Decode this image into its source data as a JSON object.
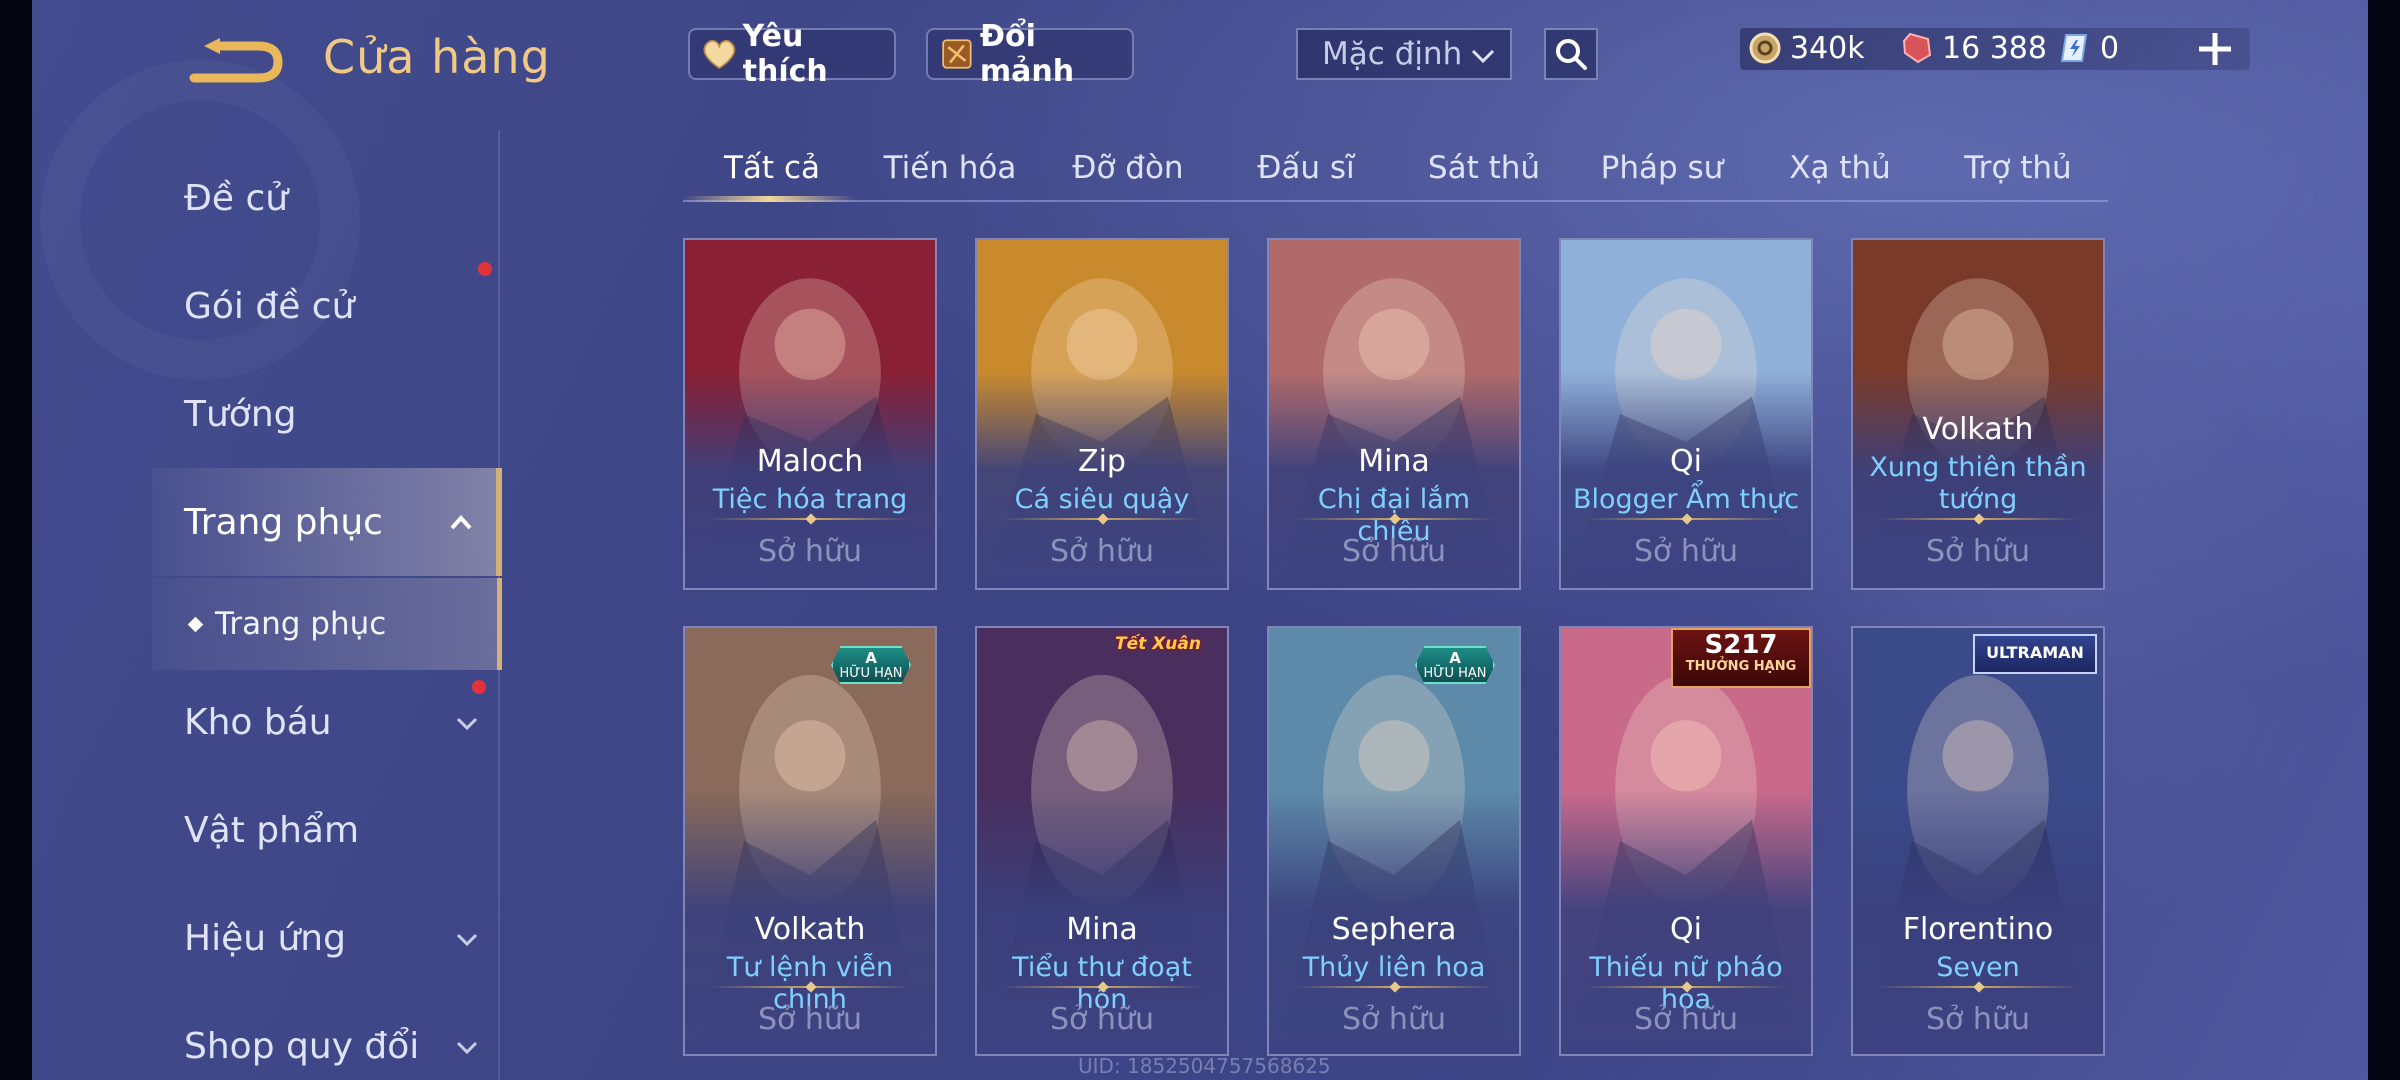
{
  "header": {
    "title": "Cửa hàng",
    "favorites_label": "Yêu thích",
    "exchange_label": "Đổi mảnh",
    "sort_value": "Mặc định"
  },
  "currency": {
    "gold": "340k",
    "gems": "16 388",
    "vouchers": "0"
  },
  "sidebar": {
    "items": [
      {
        "label": "Đề cử"
      },
      {
        "label": "Gói đề cử"
      },
      {
        "label": "Tướng"
      },
      {
        "label": "Trang phục"
      },
      {
        "label": "Kho báu"
      },
      {
        "label": "Vật phẩm"
      },
      {
        "label": "Hiệu ứng"
      },
      {
        "label": "Shop quy đổi"
      }
    ],
    "sub_item": "Trang phục"
  },
  "tabs": [
    "Tất cả",
    "Tiến hóa",
    "Đỡ đòn",
    "Đấu sĩ",
    "Sát thủ",
    "Pháp sư",
    "Xạ thủ",
    "Trợ thủ"
  ],
  "cards": [
    {
      "hero": "Maloch",
      "skin": "Tiệc hóa trang",
      "status": "Sở hữu",
      "art": "#8a2035"
    },
    {
      "hero": "Zip",
      "skin": "Cá siêu quậy",
      "status": "Sở hữu",
      "art": "#c98a2e"
    },
    {
      "hero": "Mina",
      "skin": "Chị đại lắm chiêu",
      "status": "Sở hữu",
      "art": "#b06a6a"
    },
    {
      "hero": "Qi",
      "skin": "Blogger Ẩm thực",
      "status": "Sở hữu",
      "art": "#8fb0d8"
    },
    {
      "hero": "Volkath",
      "skin": "Xung thiên thần tướng",
      "status": "Sở hữu",
      "art": "#7a3a2a"
    },
    {
      "hero": "Volkath",
      "skin": "Tư lệnh viễn chinh",
      "status": "Sở hữu",
      "art": "#8a6a5a",
      "badge": {
        "top": "A",
        "bottom": "HỮU HẠN"
      }
    },
    {
      "hero": "Mina",
      "skin": "Tiểu thư đoạt hồn",
      "status": "Sở hữu",
      "art": "#4a2f5e",
      "tag": "Tết Xuân"
    },
    {
      "hero": "Sephera",
      "skin": "Thủy liên hoa",
      "status": "Sở hữu",
      "art": "#5d8aa8",
      "badge": {
        "top": "A",
        "bottom": "HỮU HẠN"
      }
    },
    {
      "hero": "Qi",
      "skin": "Thiếu nữ pháo hoa",
      "status": "Sở hữu",
      "art": "#c96a8a",
      "rank": {
        "top": "S217",
        "bottom": "THƯỞNG HẠNG"
      }
    },
    {
      "hero": "Florentino",
      "skin": "Seven",
      "status": "Sở hữu",
      "art": "#3b4b8a",
      "collab": "ULTRAMAN"
    }
  ],
  "uid": "UID: 1852504757568625"
}
